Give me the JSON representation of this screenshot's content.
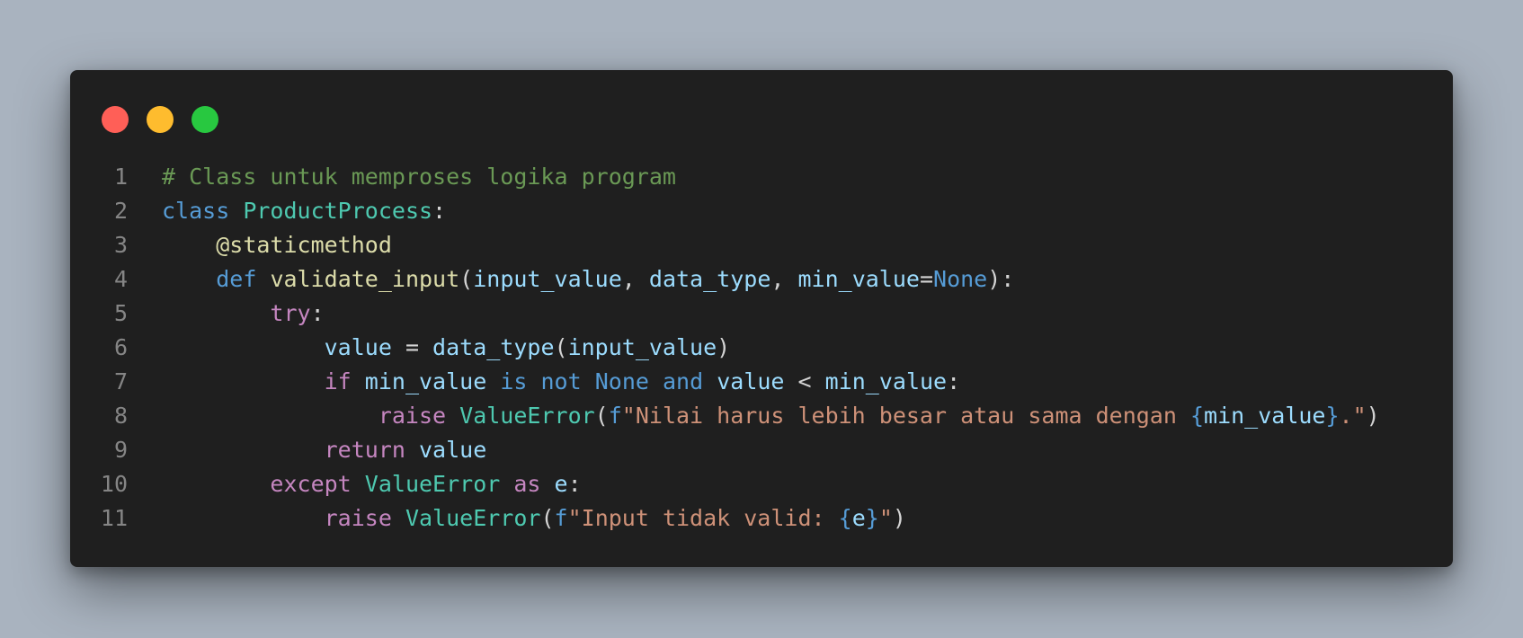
{
  "window": {
    "buttons": [
      {
        "name": "close",
        "color": "#ff5f57"
      },
      {
        "name": "minimize",
        "color": "#febc2e"
      },
      {
        "name": "maximize",
        "color": "#28c840"
      }
    ]
  },
  "colors": {
    "comment": "#6a9955",
    "keyword": "#569cd6",
    "control": "#c586c0",
    "class": "#4ec9b0",
    "function": "#dcdcaa",
    "variable": "#9cdcfe",
    "string": "#ce9178",
    "text": "#d4d4d4",
    "line_number": "#858585",
    "background": "#1f1f1f"
  },
  "code": {
    "lines": [
      {
        "number": "1",
        "tokens": [
          {
            "text": "# Class untuk memproses logika program",
            "type": "comment"
          }
        ]
      },
      {
        "number": "2",
        "tokens": [
          {
            "text": "class",
            "type": "keyword"
          },
          {
            "text": " ",
            "type": "punct"
          },
          {
            "text": "ProductProcess",
            "type": "class"
          },
          {
            "text": ":",
            "type": "punct"
          }
        ]
      },
      {
        "number": "3",
        "tokens": [
          {
            "text": "    ",
            "type": "punct"
          },
          {
            "text": "@staticmethod",
            "type": "decorator"
          }
        ]
      },
      {
        "number": "4",
        "tokens": [
          {
            "text": "    ",
            "type": "punct"
          },
          {
            "text": "def",
            "type": "keyword"
          },
          {
            "text": " ",
            "type": "punct"
          },
          {
            "text": "validate_input",
            "type": "function"
          },
          {
            "text": "(",
            "type": "punct"
          },
          {
            "text": "input_value",
            "type": "variable"
          },
          {
            "text": ", ",
            "type": "punct"
          },
          {
            "text": "data_type",
            "type": "variable"
          },
          {
            "text": ", ",
            "type": "punct"
          },
          {
            "text": "min_value",
            "type": "variable"
          },
          {
            "text": "=",
            "type": "punct"
          },
          {
            "text": "None",
            "type": "const"
          },
          {
            "text": "):",
            "type": "punct"
          }
        ]
      },
      {
        "number": "5",
        "tokens": [
          {
            "text": "        ",
            "type": "punct"
          },
          {
            "text": "try",
            "type": "control"
          },
          {
            "text": ":",
            "type": "punct"
          }
        ]
      },
      {
        "number": "6",
        "tokens": [
          {
            "text": "            ",
            "type": "punct"
          },
          {
            "text": "value",
            "type": "variable"
          },
          {
            "text": " = ",
            "type": "punct"
          },
          {
            "text": "data_type",
            "type": "variable"
          },
          {
            "text": "(",
            "type": "punct"
          },
          {
            "text": "input_value",
            "type": "variable"
          },
          {
            "text": ")",
            "type": "punct"
          }
        ]
      },
      {
        "number": "7",
        "tokens": [
          {
            "text": "            ",
            "type": "punct"
          },
          {
            "text": "if",
            "type": "control"
          },
          {
            "text": " ",
            "type": "punct"
          },
          {
            "text": "min_value",
            "type": "variable"
          },
          {
            "text": " ",
            "type": "punct"
          },
          {
            "text": "is",
            "type": "keyword"
          },
          {
            "text": " ",
            "type": "punct"
          },
          {
            "text": "not",
            "type": "keyword"
          },
          {
            "text": " ",
            "type": "punct"
          },
          {
            "text": "None",
            "type": "const"
          },
          {
            "text": " ",
            "type": "punct"
          },
          {
            "text": "and",
            "type": "keyword"
          },
          {
            "text": " ",
            "type": "punct"
          },
          {
            "text": "value",
            "type": "variable"
          },
          {
            "text": " < ",
            "type": "punct"
          },
          {
            "text": "min_value",
            "type": "variable"
          },
          {
            "text": ":",
            "type": "punct"
          }
        ]
      },
      {
        "number": "8",
        "tokens": [
          {
            "text": "                ",
            "type": "punct"
          },
          {
            "text": "raise",
            "type": "control"
          },
          {
            "text": " ",
            "type": "punct"
          },
          {
            "text": "ValueError",
            "type": "class"
          },
          {
            "text": "(",
            "type": "punct"
          },
          {
            "text": "f",
            "type": "keyword"
          },
          {
            "text": "\"Nilai harus lebih besar atau sama dengan ",
            "type": "string"
          },
          {
            "text": "{",
            "type": "keyword"
          },
          {
            "text": "min_value",
            "type": "variable"
          },
          {
            "text": "}",
            "type": "keyword"
          },
          {
            "text": ".\"",
            "type": "string"
          },
          {
            "text": ")",
            "type": "punct"
          }
        ]
      },
      {
        "number": "9",
        "tokens": [
          {
            "text": "            ",
            "type": "punct"
          },
          {
            "text": "return",
            "type": "control"
          },
          {
            "text": " ",
            "type": "punct"
          },
          {
            "text": "value",
            "type": "variable"
          }
        ]
      },
      {
        "number": "10",
        "tokens": [
          {
            "text": "        ",
            "type": "punct"
          },
          {
            "text": "except",
            "type": "control"
          },
          {
            "text": " ",
            "type": "punct"
          },
          {
            "text": "ValueError",
            "type": "class"
          },
          {
            "text": " ",
            "type": "punct"
          },
          {
            "text": "as",
            "type": "control"
          },
          {
            "text": " ",
            "type": "punct"
          },
          {
            "text": "e",
            "type": "variable"
          },
          {
            "text": ":",
            "type": "punct"
          }
        ]
      },
      {
        "number": "11",
        "tokens": [
          {
            "text": "            ",
            "type": "punct"
          },
          {
            "text": "raise",
            "type": "control"
          },
          {
            "text": " ",
            "type": "punct"
          },
          {
            "text": "ValueError",
            "type": "class"
          },
          {
            "text": "(",
            "type": "punct"
          },
          {
            "text": "f",
            "type": "keyword"
          },
          {
            "text": "\"Input tidak valid: ",
            "type": "string"
          },
          {
            "text": "{",
            "type": "keyword"
          },
          {
            "text": "e",
            "type": "variable"
          },
          {
            "text": "}",
            "type": "keyword"
          },
          {
            "text": "\"",
            "type": "string"
          },
          {
            "text": ")",
            "type": "punct"
          }
        ]
      }
    ]
  }
}
